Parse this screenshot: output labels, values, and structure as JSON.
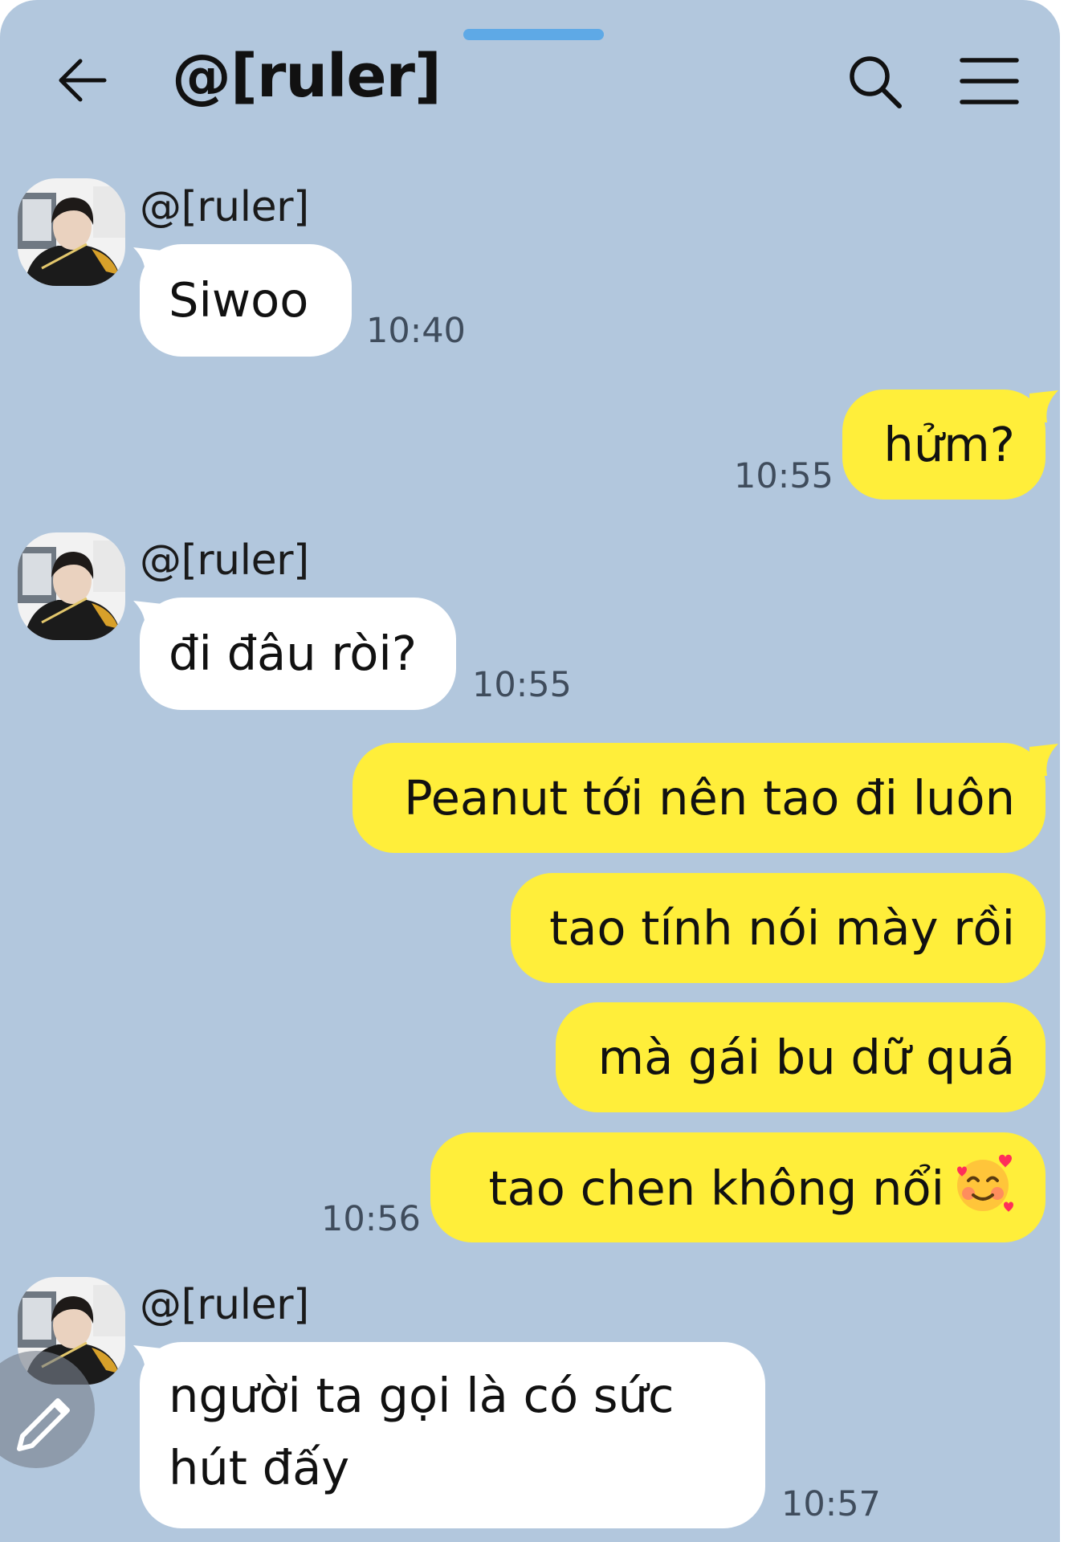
{
  "header": {
    "title": "@[ruler]"
  },
  "messages": [
    {
      "direction": "in",
      "sender": "@[ruler]",
      "text": "Siwoo",
      "time": "10:40"
    },
    {
      "direction": "out",
      "text": "hửm?",
      "time": "10:55"
    },
    {
      "direction": "in",
      "sender": "@[ruler]",
      "text": "đi đâu ròi?",
      "time": "10:55"
    },
    {
      "direction": "out",
      "text": "Peanut tới nên tao đi luôn"
    },
    {
      "direction": "out",
      "text": "tao tính nói mày rồi"
    },
    {
      "direction": "out",
      "text": "mà gái bu dữ quá"
    },
    {
      "direction": "out",
      "text": "tao chen không nổi",
      "emoji": "smiling-face-with-hearts",
      "time": "10:56"
    },
    {
      "direction": "in",
      "sender": "@[ruler]",
      "text": "người ta gọi là có sức hút đấy",
      "time": "10:57"
    }
  ],
  "colors": {
    "background": "#b2c7dd",
    "incoming_bubble": "#ffffff",
    "outgoing_bubble": "#ffee3a",
    "drag_handle": "#5ea9e6"
  }
}
